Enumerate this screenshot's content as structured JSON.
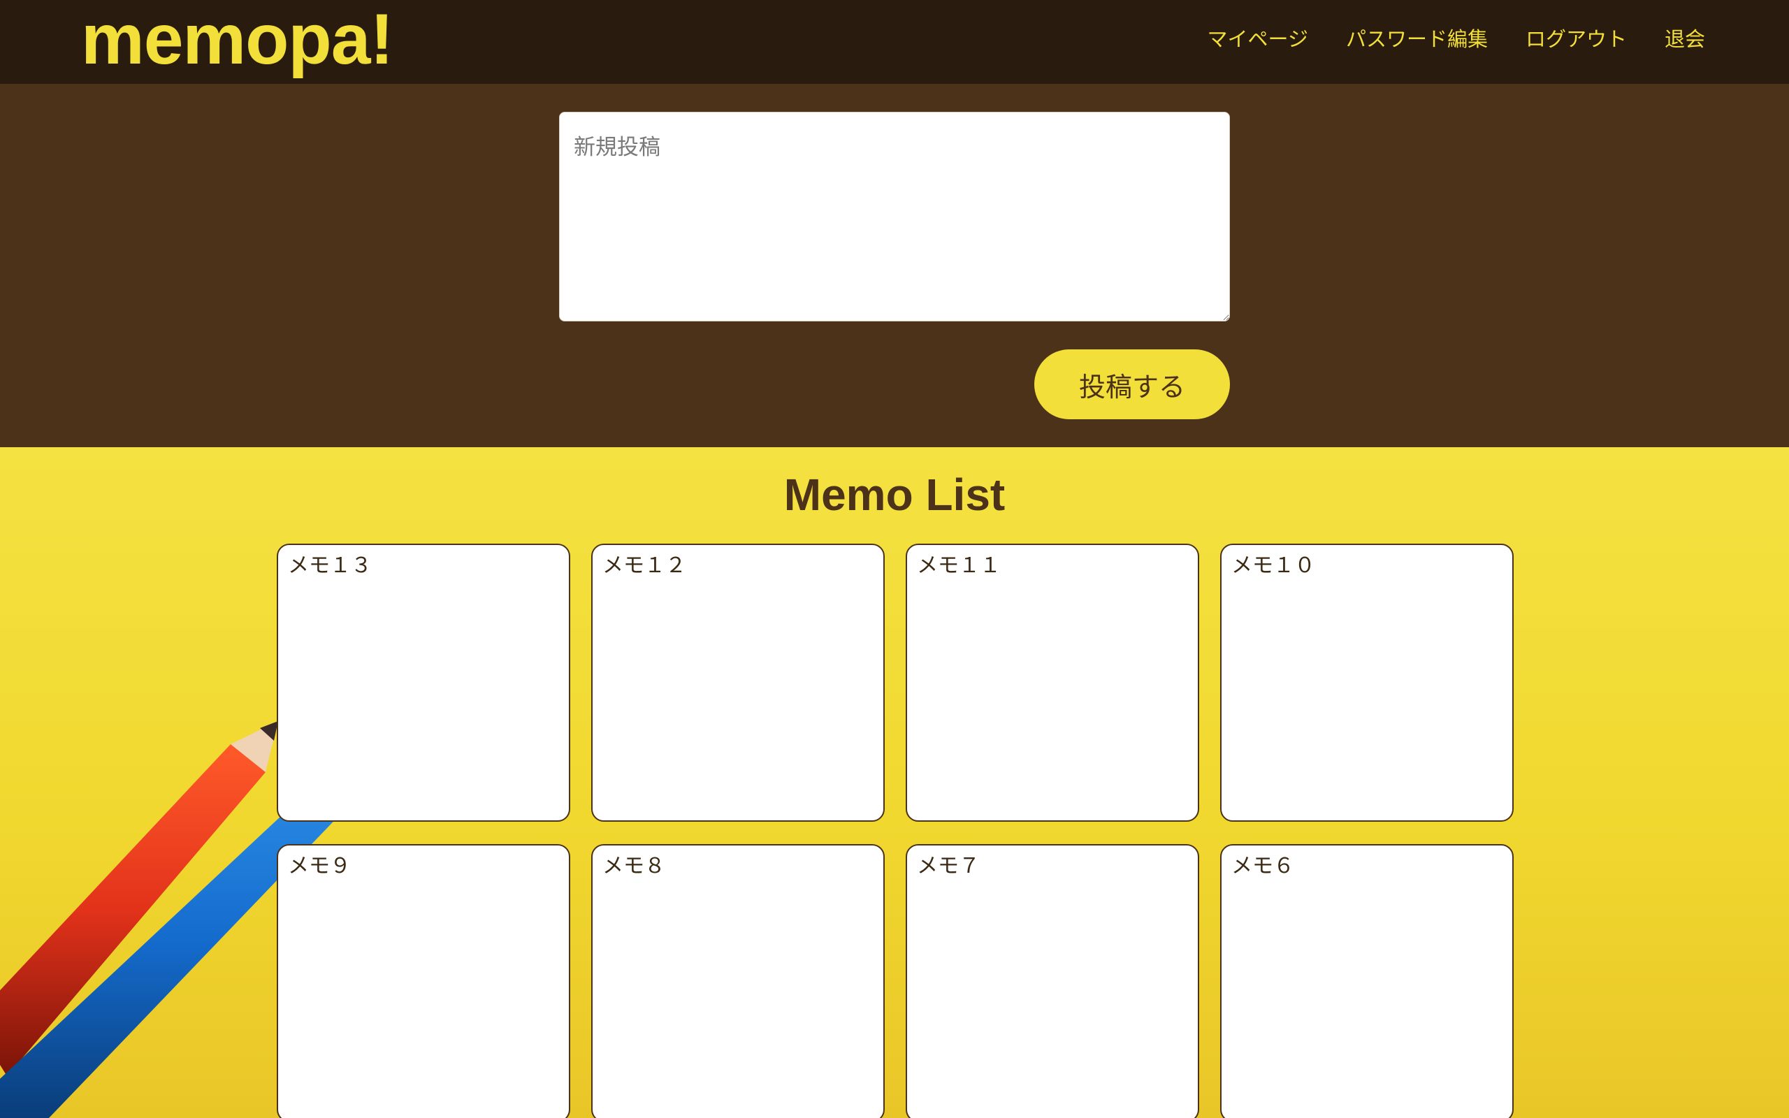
{
  "header": {
    "logo": "memopa!",
    "nav": [
      "マイページ",
      "パスワード編集",
      "ログアウト",
      "退会"
    ]
  },
  "post": {
    "placeholder": "新規投稿",
    "value": "",
    "button_label": "投稿する"
  },
  "memo_list": {
    "title": "Memo List",
    "memos": [
      "メモ１３",
      "メモ１２",
      "メモ１１",
      "メモ１０",
      "メモ９",
      "メモ８",
      "メモ７",
      "メモ６"
    ]
  },
  "colors": {
    "header_bg": "#291b0d",
    "post_bg": "#4b3218",
    "accent_yellow": "#f3df3a",
    "text_brown": "#4b3218"
  }
}
